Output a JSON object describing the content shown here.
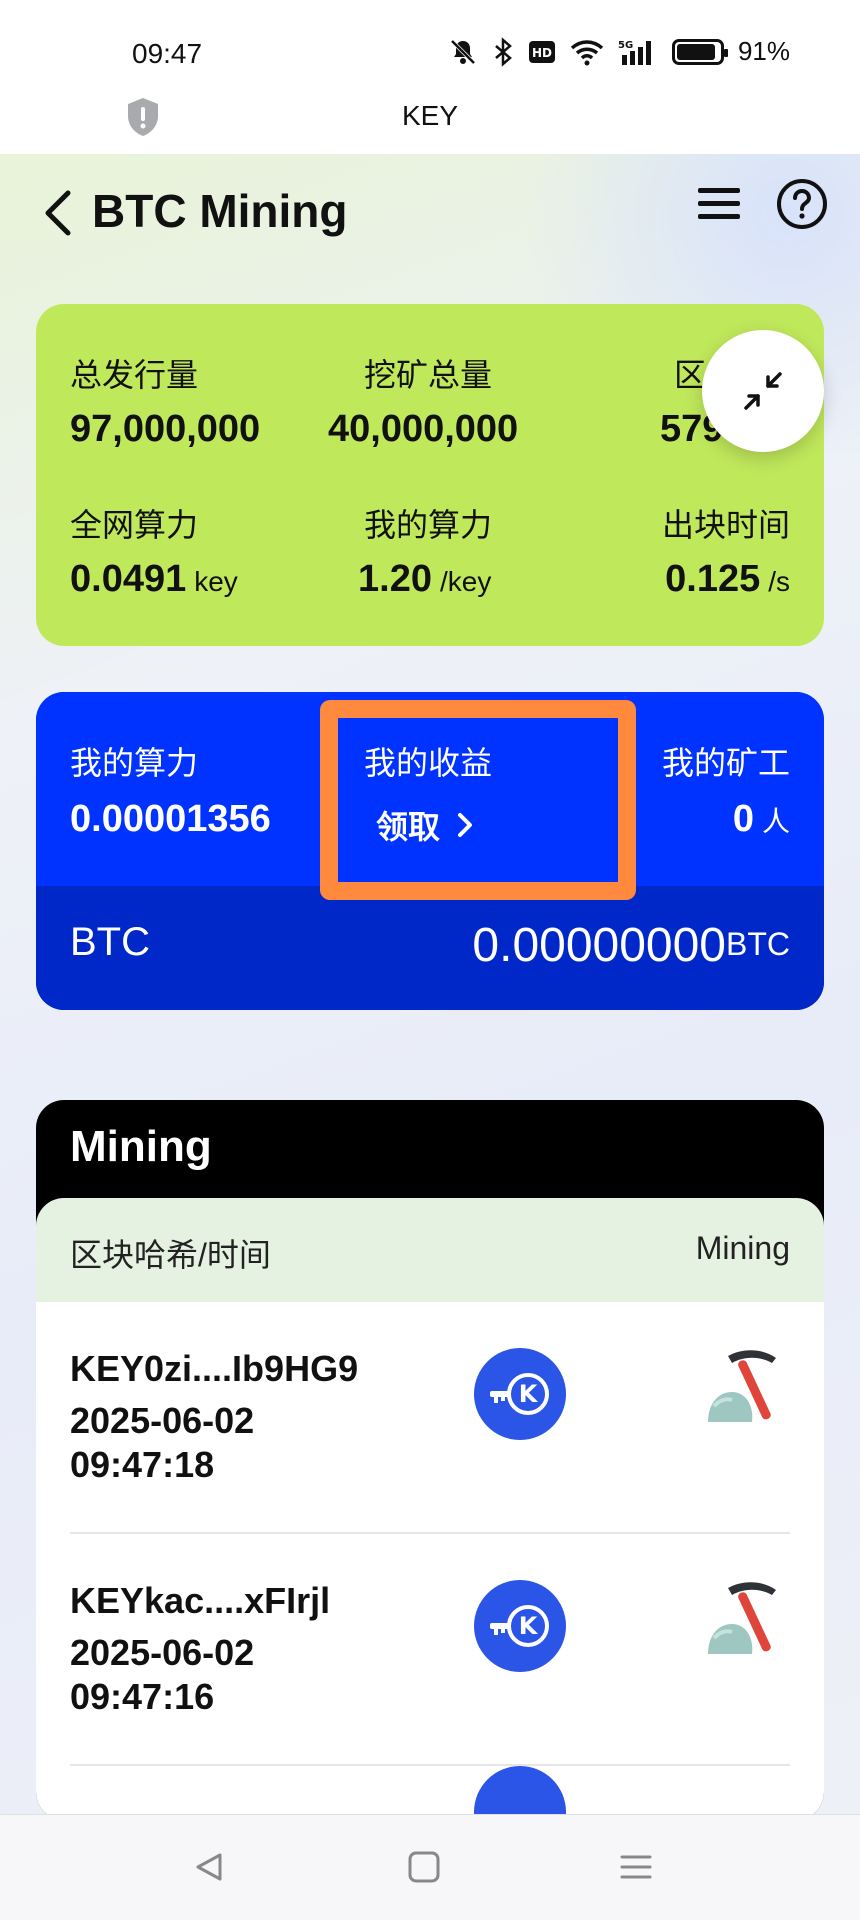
{
  "status_bar": {
    "time": "09:47",
    "network": "5G",
    "battery": "91%",
    "battery_level": 0.91
  },
  "app_bar": {
    "title": "KEY",
    "shield_icon": "shield-alert-icon"
  },
  "header": {
    "title": "BTC Mining",
    "back_icon": "chevron-left-icon",
    "menu_icon": "hamburger-menu-icon",
    "help_icon": "question-circle-icon"
  },
  "stats": {
    "total_issuance": {
      "label": "总发行量",
      "value": "97,000,000"
    },
    "total_mining": {
      "label": "挖矿总量",
      "value": "40,000,000"
    },
    "block": {
      "label": "区块",
      "value": "5790"
    },
    "network_hashrate": {
      "label": "全网算力",
      "value": "0.0491",
      "unit": "key"
    },
    "my_hashrate": {
      "label": "我的算力",
      "value": "1.20",
      "unit": "/key"
    },
    "block_time": {
      "label": "出块时间",
      "value": "0.125",
      "unit": "/s"
    }
  },
  "earnings": {
    "my_hashrate": {
      "label": "我的算力",
      "value": "0.00001356"
    },
    "my_earnings": {
      "label": "我的收益",
      "claim_label": "领取"
    },
    "my_miners": {
      "label": "我的矿工",
      "value": "0",
      "unit": "人"
    },
    "btc_label": "BTC",
    "btc_value": "0.00000000",
    "btc_unit": "BTC"
  },
  "mining": {
    "title": "Mining",
    "col_hash_time": "区块哈希/时间",
    "col_mining": "Mining",
    "rows": [
      {
        "hash": "KEY0zi....Ib9HG9",
        "date": "2025-06-02",
        "time": "09:47:18"
      },
      {
        "hash": "KEYkac....xFIrjl",
        "date": "2025-06-02",
        "time": "09:47:16"
      }
    ]
  },
  "colors": {
    "stats_card": "#c0e85b",
    "earnings_top": "#0033ff",
    "earnings_bottom": "#0028c8",
    "highlight": "#ff8a3d",
    "coin": "#2a55e6"
  }
}
